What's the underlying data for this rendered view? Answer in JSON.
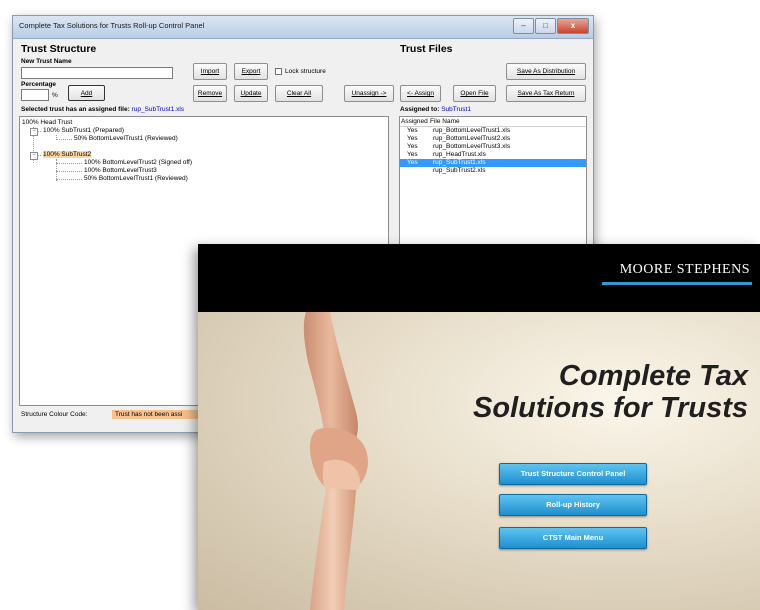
{
  "window": {
    "title": "Complete Tax Solutions for Trusts Roll-up Control Panel",
    "controls": {
      "minimize": "–",
      "maximize": "□",
      "close": "x"
    }
  },
  "trust_structure": {
    "heading": "Trust Structure",
    "new_trust_name_label": "New Trust Name",
    "new_trust_name_value": "",
    "percentage_label": "Percentage",
    "percent_sign": "%",
    "percentage_value": "",
    "buttons": {
      "add": "Add",
      "import": "Import",
      "export": "Export",
      "remove": "Remove",
      "update": "Update",
      "clear_all": "Clear All",
      "unassign": "Unassign ->"
    },
    "lock_structure_label": "Lock structure",
    "selected_label": "Selected trust has an assigned file:",
    "selected_file": "rup_SubTrust1.xls",
    "tree": [
      {
        "text": "100% Head Trust",
        "level": 0,
        "highlight": false
      },
      {
        "text": "100% SubTrust1 (Prepared)",
        "level": 1,
        "highlight": false
      },
      {
        "text": "50% BottomLevelTrust1 (Reviewed)",
        "level": 2,
        "highlight": false
      },
      {
        "text": "100% SubTrust2",
        "level": 1,
        "highlight": true
      },
      {
        "text": "100% BottomLevelTrust2 (Signed off)",
        "level": 2,
        "highlight": false
      },
      {
        "text": "100% BottomLevelTrust3",
        "level": 2,
        "highlight": false
      },
      {
        "text": "50% BottomLevelTrust1 (Reviewed)",
        "level": 2,
        "highlight": false
      }
    ],
    "colour_code_label": "Structure Colour Code:",
    "colour_code_value": "Trust has not been assi",
    "colour_code_color": "#f7c28c"
  },
  "trust_files": {
    "heading": "Trust Files",
    "buttons": {
      "save_as_distribution": "Save As Distribution",
      "assign": "<- Assign",
      "open_file": "Open File",
      "save_as_tax_return": "Save As Tax Return"
    },
    "assigned_to_label": "Assigned to:",
    "assigned_to_value": "SubTrust1",
    "columns": [
      "Assigned",
      "File Name"
    ],
    "rows": [
      {
        "assigned": "Yes",
        "file": "rup_BottomLevelTrust1.xls",
        "selected": false
      },
      {
        "assigned": "Yes",
        "file": "rup_BottomLevelTrust2.xls",
        "selected": false
      },
      {
        "assigned": "Yes",
        "file": "rup_BottomLevelTrust3.xls",
        "selected": false
      },
      {
        "assigned": "Yes",
        "file": "rup_HeadTrust.xls",
        "selected": false
      },
      {
        "assigned": "Yes",
        "file": "rup_SubTrust1.xls",
        "selected": true
      },
      {
        "assigned": "",
        "file": "rup_SubTrust2.xls",
        "selected": false
      }
    ],
    "selection_color": "#3399ff"
  },
  "splash": {
    "brand": "MOORE STEPHENS",
    "brand_accent": "#2f9bd6",
    "title_line1": "Complete Tax",
    "title_line2": "Solutions for Trusts",
    "buttons": {
      "control_panel": "Trust  Structure Control  Panel",
      "rollup_history": "Roll-up History",
      "main_menu": "CTST Main Menu"
    },
    "button_color": "#2fa4e0"
  }
}
